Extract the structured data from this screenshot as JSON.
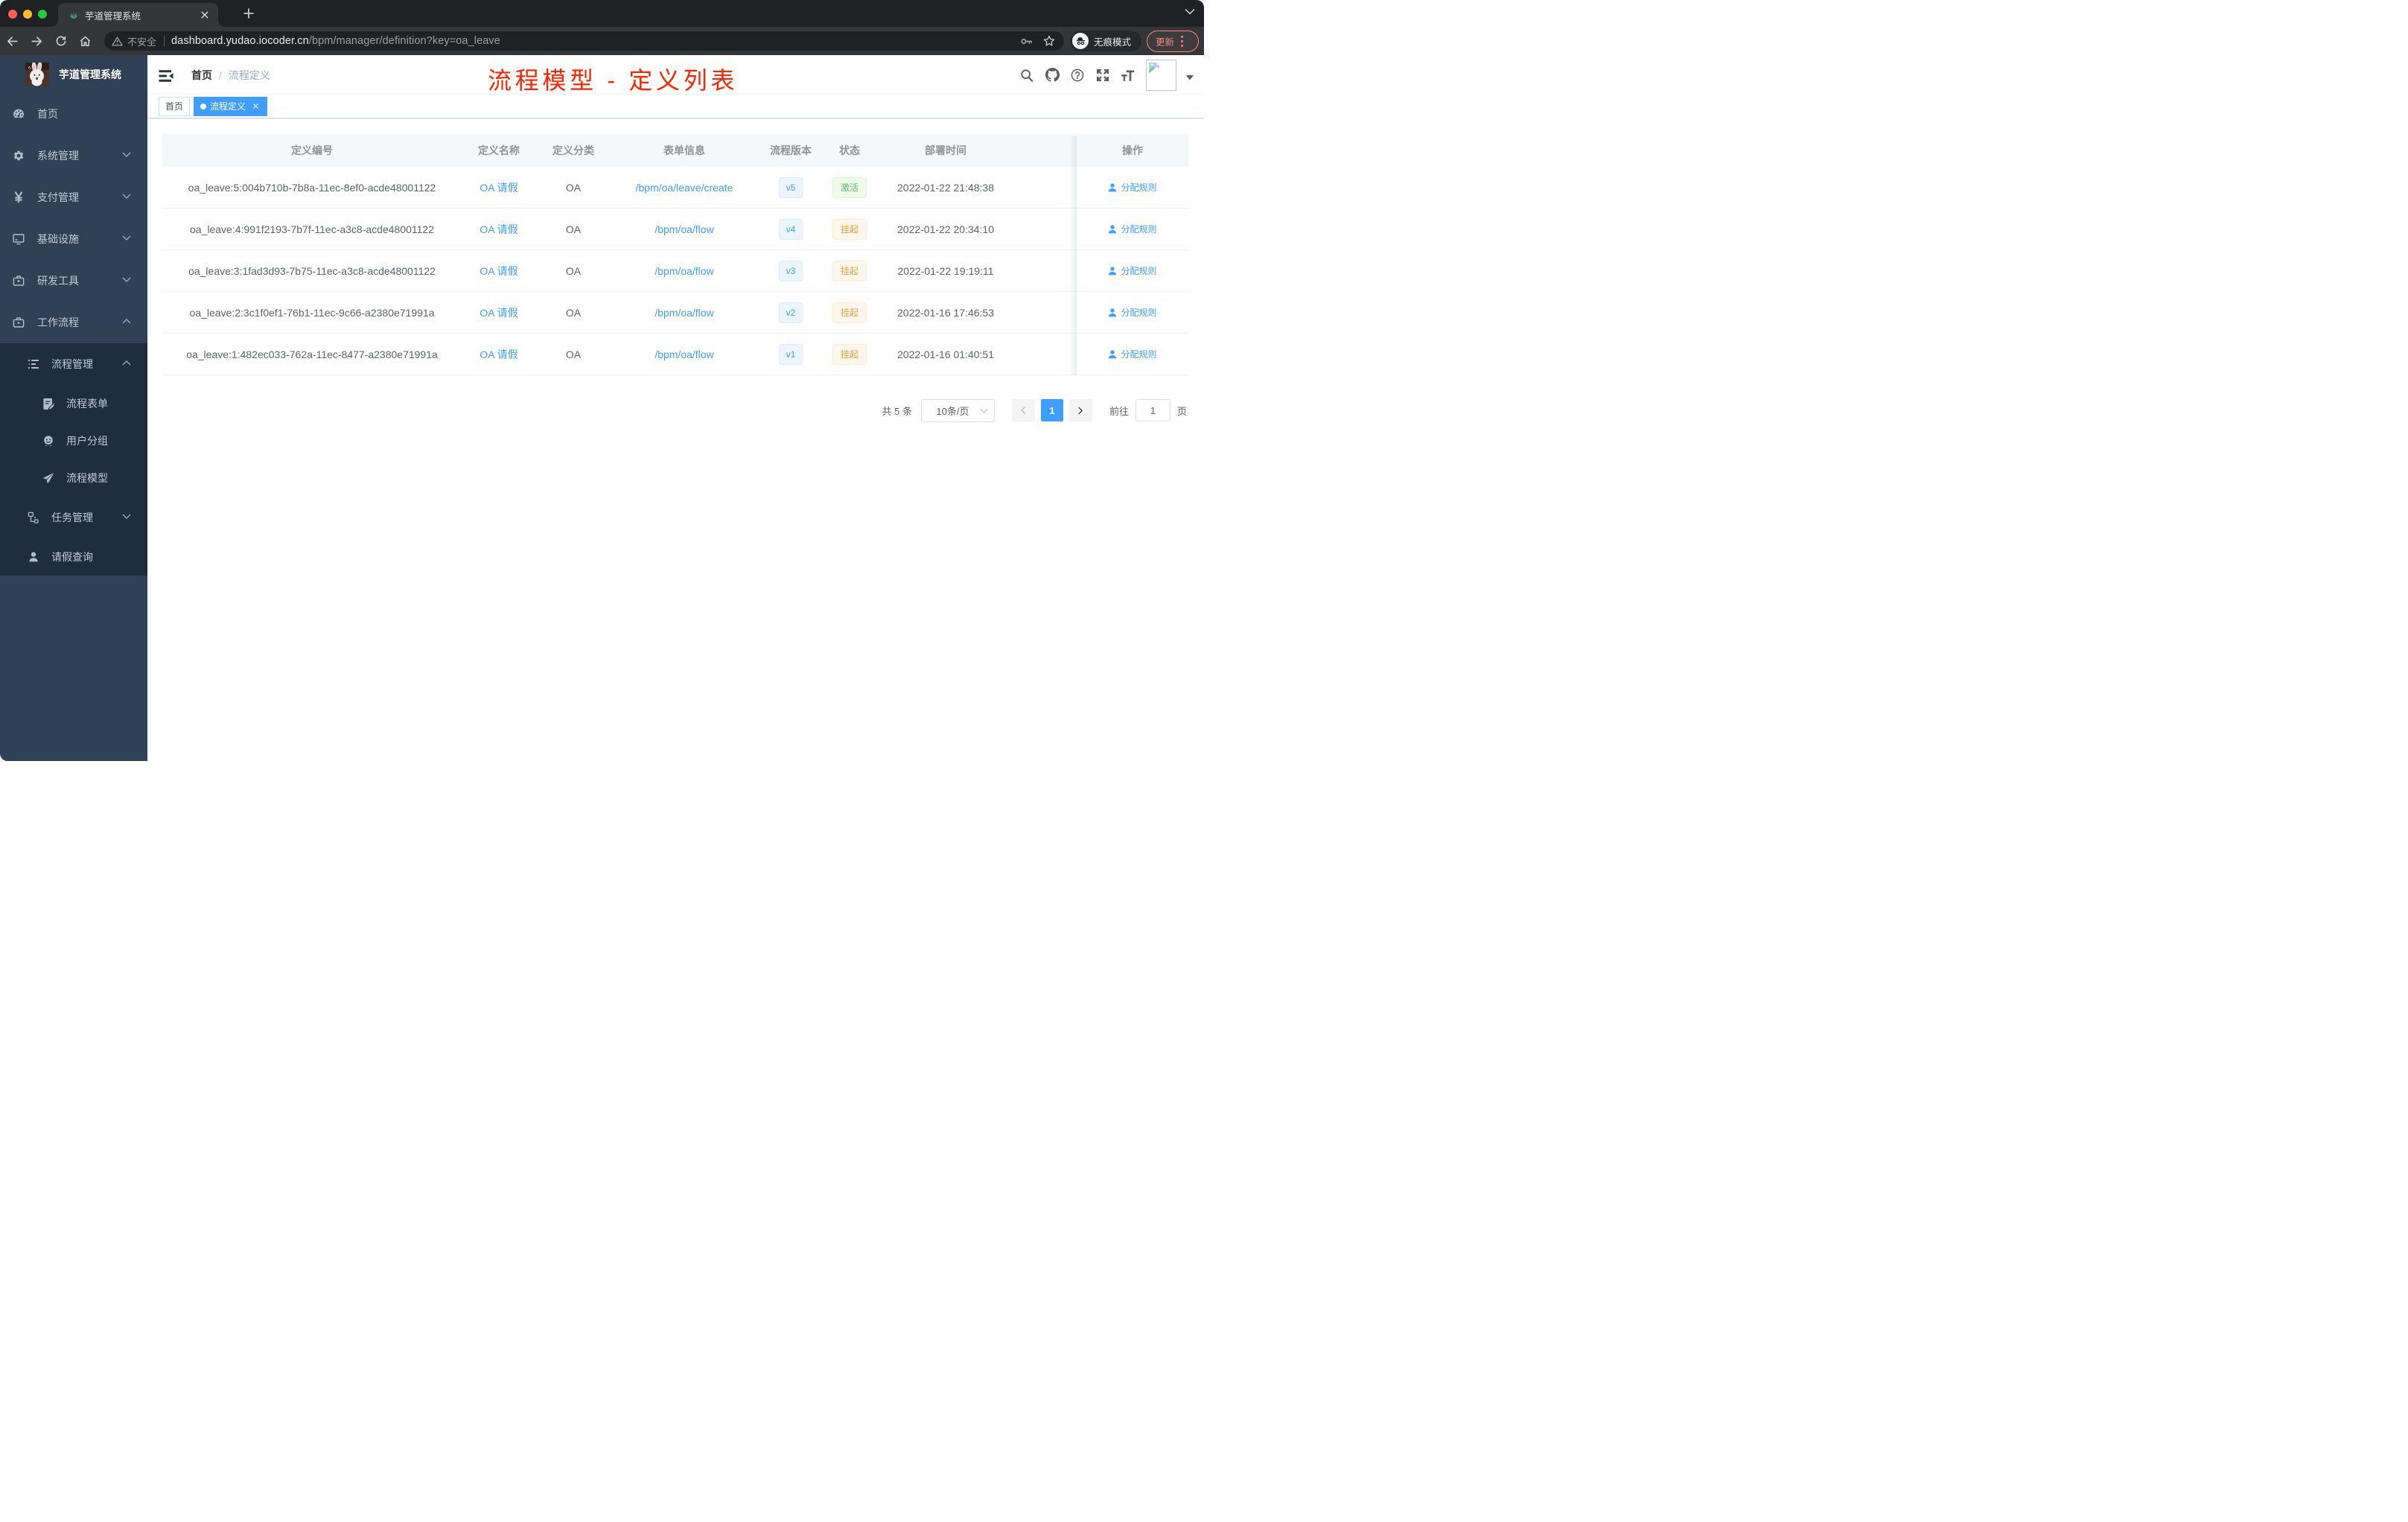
{
  "browser": {
    "tab_title": "芋道管理系统",
    "security_label": "不安全",
    "url_host": "dashboard.yudao.iocoder.cn",
    "url_path": "/bpm/manager/definition?key=oa_leave",
    "incognito_label": "无痕模式",
    "update_label": "更新",
    "traffic_colors": {
      "close": "#ff5f57",
      "minimize": "#febc2e",
      "zoom": "#28c840"
    }
  },
  "sidebar": {
    "logo_title": "芋道管理系统",
    "items": [
      {
        "label": "首页",
        "icon": "dashboard-icon",
        "cls": "d1 h56",
        "chevron": ""
      },
      {
        "label": "系统管理",
        "icon": "gear-icon",
        "cls": "d1 h56",
        "chevron": "down"
      },
      {
        "label": "支付管理",
        "icon": "yuan-icon",
        "cls": "d1 h56",
        "chevron": "down"
      },
      {
        "label": "基础设施",
        "icon": "monitor-icon",
        "cls": "d1 h56",
        "chevron": "down"
      },
      {
        "label": "研发工具",
        "icon": "toolbox-icon",
        "cls": "d1 h56",
        "chevron": "down"
      },
      {
        "label": "工作流程",
        "icon": "briefcase-icon",
        "cls": "d1 h56",
        "chevron": "up"
      },
      {
        "label": "流程管理",
        "icon": "tree-table-icon",
        "cls": "d2 h56 submenu-bg",
        "chevron": "up"
      },
      {
        "label": "流程表单",
        "icon": "form-icon",
        "cls": "d3 h50 submenu-bg",
        "chevron": ""
      },
      {
        "label": "用户分组",
        "icon": "peoples-icon",
        "cls": "d3 h50 submenu-bg",
        "chevron": ""
      },
      {
        "label": "流程模型",
        "icon": "send-icon",
        "cls": "d3 h50 submenu-bg",
        "chevron": ""
      },
      {
        "label": "任务管理",
        "icon": "tree-icon",
        "cls": "d2 h56 submenu-bg",
        "chevron": "down"
      },
      {
        "label": "请假查询",
        "icon": "user-icon",
        "cls": "d2 h50 submenu-bg",
        "chevron": ""
      }
    ]
  },
  "header": {
    "breadcrumb_home": "首页",
    "breadcrumb_separator": "/",
    "breadcrumb_current": "流程定义",
    "annotation": "流程模型 - 定义列表"
  },
  "tags": [
    {
      "label": "首页",
      "cls": "",
      "dot": false,
      "closable": false
    },
    {
      "label": "流程定义",
      "cls": "active",
      "dot": true,
      "closable": true
    }
  ],
  "table": {
    "columns": [
      {
        "label": "定义编号"
      },
      {
        "label": "定义名称"
      },
      {
        "label": "定义分类"
      },
      {
        "label": "表单信息"
      },
      {
        "label": "流程版本"
      },
      {
        "label": "状态"
      },
      {
        "label": "部署时间"
      },
      {
        "label": ""
      },
      {
        "label": "操作"
      }
    ],
    "rows": [
      {
        "id": "oa_leave:5:004b710b-7b8a-11ec-8ef0-acde48001122",
        "name": "OA 请假",
        "category": "OA",
        "form": "/bpm/oa/leave/create",
        "version": "v5",
        "status": "激活",
        "status_cls": "success",
        "time": "2022-01-22 21:48:38",
        "action": "分配规则"
      },
      {
        "id": "oa_leave:4:991f2193-7b7f-11ec-a3c8-acde48001122",
        "name": "OA 请假",
        "category": "OA",
        "form": "/bpm/oa/flow",
        "version": "v4",
        "status": "挂起",
        "status_cls": "warning",
        "time": "2022-01-22 20:34:10",
        "action": "分配规则"
      },
      {
        "id": "oa_leave:3:1fad3d93-7b75-11ec-a3c8-acde48001122",
        "name": "OA 请假",
        "category": "OA",
        "form": "/bpm/oa/flow",
        "version": "v3",
        "status": "挂起",
        "status_cls": "warning",
        "time": "2022-01-22 19:19:11",
        "action": "分配规则"
      },
      {
        "id": "oa_leave:2:3c1f0ef1-76b1-11ec-9c66-a2380e71991a",
        "name": "OA 请假",
        "category": "OA",
        "form": "/bpm/oa/flow",
        "version": "v2",
        "status": "挂起",
        "status_cls": "warning",
        "time": "2022-01-16 17:46:53",
        "action": "分配规则"
      },
      {
        "id": "oa_leave:1:482ec033-762a-11ec-8477-a2380e71991a",
        "name": "OA 请假",
        "category": "OA",
        "form": "/bpm/oa/flow",
        "version": "v1",
        "status": "挂起",
        "status_cls": "warning",
        "time": "2022-01-16 01:40:51",
        "action": "分配规则"
      }
    ]
  },
  "pagination": {
    "total_label": "共 5 条",
    "page_size_label": "10条/页",
    "current_page": "1",
    "goto_label": "前往",
    "goto_value": "1",
    "page_suffix": "页"
  }
}
